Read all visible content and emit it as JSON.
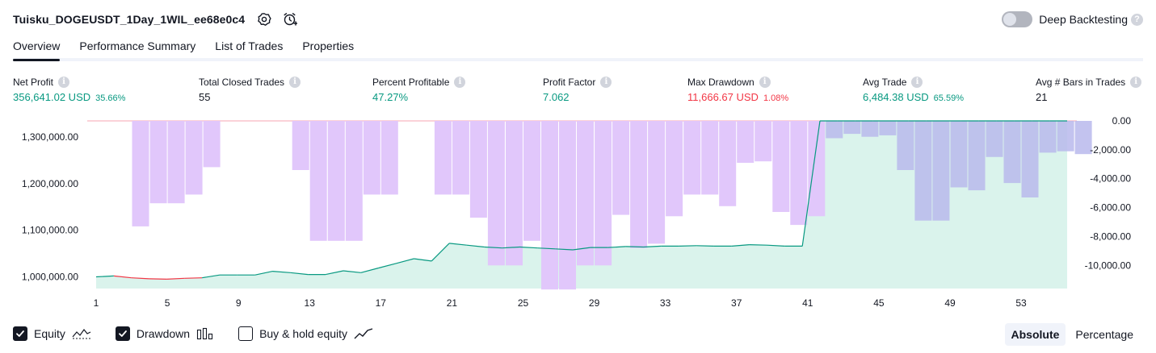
{
  "header": {
    "title": "Tuisku_DOGEUSDT_1Day_1WIL_ee68e0c4",
    "deep_backtesting_label": "Deep Backtesting",
    "help_glyph": "?"
  },
  "tabs": [
    {
      "label": "Overview",
      "active": true
    },
    {
      "label": "Performance Summary",
      "active": false
    },
    {
      "label": "List of Trades",
      "active": false
    },
    {
      "label": "Properties",
      "active": false
    }
  ],
  "stats": {
    "net_profit": {
      "label": "Net Profit",
      "value": "356,641.02 USD",
      "pct": "35.66%"
    },
    "total_closed_trades": {
      "label": "Total Closed Trades",
      "value": "55"
    },
    "percent_profitable": {
      "label": "Percent Profitable",
      "value": "47.27%"
    },
    "profit_factor": {
      "label": "Profit Factor",
      "value": "7.062"
    },
    "max_drawdown": {
      "label": "Max Drawdown",
      "value": "11,666.67 USD",
      "pct": "1.08%"
    },
    "avg_trade": {
      "label": "Avg Trade",
      "value": "6,484.38 USD",
      "pct": "65.59%"
    },
    "avg_bars": {
      "label": "Avg # Bars in Trades",
      "value": "21"
    },
    "info_glyph": "i"
  },
  "chart_data": {
    "type": "bar+area",
    "equity": {
      "name": "Equity",
      "color": "#089981",
      "negative_color": "#f23645",
      "fill": "#d6f2ea",
      "ylim": [
        975000,
        1338000
      ],
      "y_ticks": [
        "1,000,000.00",
        "1,100,000.00",
        "1,200,000.00",
        "1,300,000.00"
      ],
      "y_tick_values": [
        1000000,
        1100000,
        1200000,
        1300000
      ],
      "values": [
        1000000,
        1002000,
        998000,
        996000,
        995000,
        997000,
        998000,
        1004000,
        1004000,
        1004000,
        1012000,
        1009000,
        1005000,
        1005000,
        1013000,
        1009000,
        1019000,
        1029000,
        1039000,
        1034000,
        1072000,
        1068000,
        1064000,
        1062000,
        1064000,
        1062000,
        1060000,
        1058000,
        1063000,
        1063000,
        1065000,
        1064000,
        1066000,
        1066000,
        1067000,
        1066000,
        1066000,
        1069000,
        1068000,
        1066000,
        1066000,
        1355000,
        1356000,
        1356000,
        1355000,
        1356000,
        1356000,
        1356000,
        1355000,
        1355000,
        1355000,
        1354000,
        1354000,
        1354000,
        1355000,
        1356000
      ]
    },
    "drawdown": {
      "name": "Drawdown",
      "color": "#e1c7fb",
      "overlay_color": "#b8b8ec",
      "ylim": [
        -11600,
        0
      ],
      "y_ticks": [
        "0.00",
        "-2,000.00",
        "-4,000.00",
        "-6,000.00",
        "-8,000.00",
        "-10,000.00"
      ],
      "y_tick_values": [
        0,
        -2000,
        -4000,
        -6000,
        -8000,
        -10000
      ],
      "values": [
        0,
        0,
        -7300,
        -5700,
        -5700,
        -5100,
        -3200,
        0,
        0,
        0,
        0,
        -3400,
        -8300,
        -8300,
        -8300,
        -5100,
        -5100,
        0,
        0,
        -5100,
        -5100,
        -6700,
        -10000,
        -10000,
        -8300,
        -11666.67,
        -11666.67,
        -10000,
        -10000,
        -6500,
        -8800,
        -8500,
        -6600,
        -5100,
        -5100,
        -5900,
        -2900,
        -2800,
        -6300,
        -7200,
        -6600,
        -1200,
        -900,
        -1100,
        -1000,
        -3400,
        -6900,
        -6900,
        -4600,
        -4800,
        -2500,
        -4300,
        -5300,
        -2200,
        -2100,
        -2300
      ]
    },
    "x_ticks": [
      1,
      5,
      9,
      13,
      17,
      21,
      25,
      29,
      33,
      37,
      41,
      45,
      49,
      53
    ],
    "n_trades": 55
  },
  "legend": {
    "equity": {
      "label": "Equity",
      "checked": true
    },
    "drawdown": {
      "label": "Drawdown",
      "checked": true
    },
    "buy_hold": {
      "label": "Buy & hold equity",
      "checked": false
    }
  },
  "mode": {
    "absolute": "Absolute",
    "percentage": "Percentage"
  }
}
